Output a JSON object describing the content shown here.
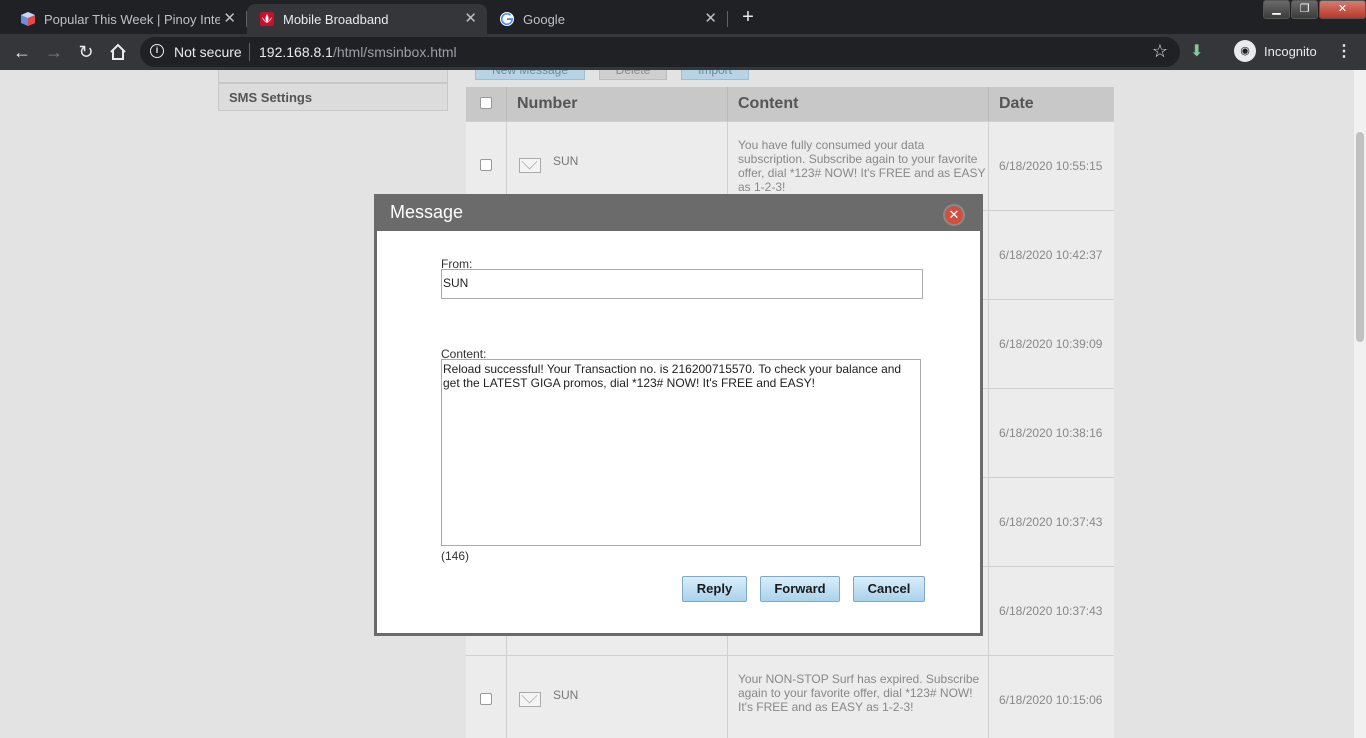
{
  "browser": {
    "tabs": [
      {
        "title": "Popular This Week | Pinoy Intern",
        "active": false
      },
      {
        "title": "Mobile Broadband",
        "active": true
      },
      {
        "title": "Google",
        "active": false
      }
    ],
    "omnibox": {
      "security": "Not secure",
      "url_host": "192.168.8.1",
      "url_path": "/html/smsinbox.html"
    },
    "profile": "Incognito"
  },
  "sidebar": {
    "items": [
      {
        "label": ""
      },
      {
        "label": "SMS Settings"
      }
    ]
  },
  "toolbar": {
    "new_message": "New Message",
    "delete": "Delete",
    "import": "Import"
  },
  "table": {
    "columns": [
      "Number",
      "Content",
      "Date"
    ],
    "rows": [
      {
        "number": "SUN",
        "content": "You have fully consumed your data subscription. Subscribe again to your favorite offer, dial *123# NOW! It's FREE and as EASY as 1-2-3!",
        "date": "6/18/2020 10:55:15"
      },
      {
        "number": "",
        "content": "",
        "date": "6/18/2020 10:42:37"
      },
      {
        "number": "",
        "content": "",
        "date": "6/18/2020 10:39:09"
      },
      {
        "number": "",
        "content": "",
        "date": "6/18/2020 10:38:16"
      },
      {
        "number": "",
        "content": "",
        "date": "6/18/2020 10:37:43"
      },
      {
        "number": "",
        "content": "",
        "date": "6/18/2020 10:37:43"
      },
      {
        "number": "SUN",
        "content": "Your NON-STOP Surf has expired. Subscribe again to your favorite offer, dial *123# NOW! It's FREE and as EASY as 1-2-3!",
        "date": "6/18/2020 10:15:06"
      }
    ]
  },
  "modal": {
    "title": "Message",
    "from_label": "From:",
    "from_value": "SUN",
    "content_label": "Content:",
    "content_value": "Reload successful! Your Transaction no. is 216200715570. To check your balance and get the LATEST GIGA promos, dial *123# NOW! It's FREE and EASY!",
    "char_count": "(146)",
    "reply": "Reply",
    "forward": "Forward",
    "cancel": "Cancel"
  },
  "colors": {
    "chrome_dark": "#202124",
    "chrome_toolbar": "#35363a",
    "button_blue": "#a9d2ec",
    "modal_header": "#6b6b6b",
    "close_red": "#d04f3f"
  }
}
